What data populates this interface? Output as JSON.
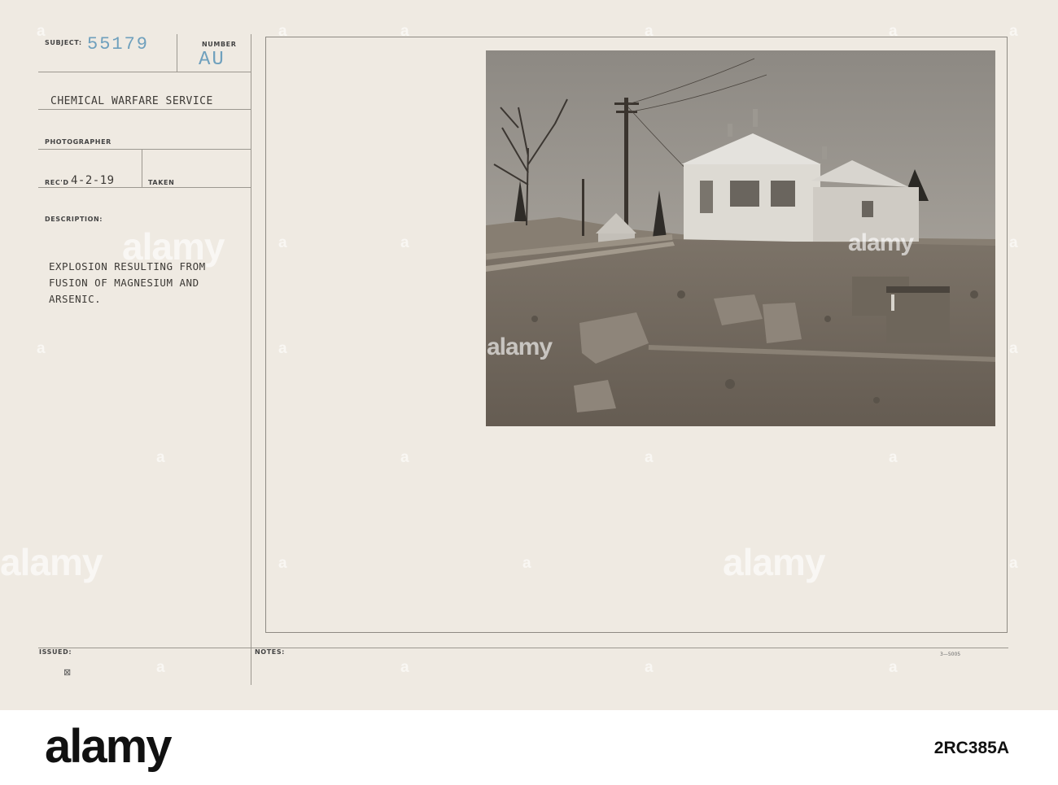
{
  "card": {
    "subject_label": "SUBJECT:",
    "subject_number": "55179",
    "number_label": "NUMBER",
    "number_stamp": "AU",
    "service": "CHEMICAL WARFARE SERVICE",
    "photographer_label": "PHOTOGRAPHER",
    "recd_label": "REC'D",
    "recd_date": "4-2-19",
    "taken_label": "TAKEN",
    "description_label": "DESCRIPTION:",
    "description_lines": [
      "EXPLOSION RESULTING FROM",
      "FUSION OF MAGNESIUM AND",
      "ARSENIC."
    ],
    "issued_label": "ISSUED:",
    "notes_label": "NOTES:",
    "form_number": "3—5005"
  },
  "watermark": {
    "brand": "alamy"
  },
  "footer": {
    "brand": "alamy",
    "image_id": "2RC385A"
  },
  "colors": {
    "card_background": "#efeae2",
    "stamp_blue": "#6fa0bd",
    "typewriter_ink": "#3d3a36",
    "photo_sepia": "#6b6257"
  }
}
